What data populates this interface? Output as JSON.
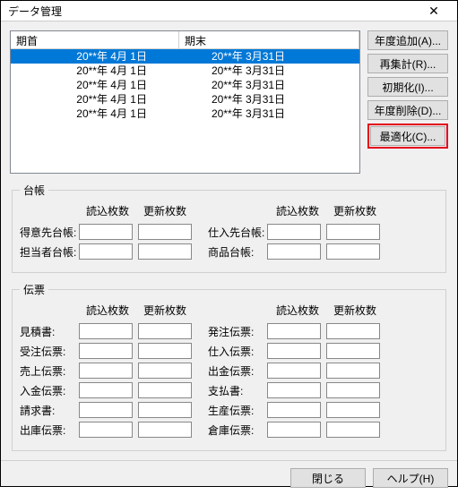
{
  "window": {
    "title": "データ管理"
  },
  "list": {
    "headers": {
      "start": "期首",
      "end": "期末"
    },
    "rows": [
      {
        "start": "20**年 4月 1日",
        "end": "20**年 3月31日",
        "selected": true
      },
      {
        "start": "20**年 4月 1日",
        "end": "20**年 3月31日",
        "selected": false
      },
      {
        "start": "20**年 4月 1日",
        "end": "20**年 3月31日",
        "selected": false
      },
      {
        "start": "20**年 4月 1日",
        "end": "20**年 3月31日",
        "selected": false
      },
      {
        "start": "20**年 4月 1日",
        "end": "20**年 3月31日",
        "selected": false
      }
    ]
  },
  "sidebuttons": {
    "add_year": "年度追加(A)...",
    "reaggregate": "再集計(R)...",
    "init": "初期化(I)...",
    "delete_year": "年度削除(D)...",
    "optimize": "最適化(C)..."
  },
  "ledger": {
    "legend": "台帳",
    "col_read": "読込枚数",
    "col_update": "更新枚数",
    "left": [
      {
        "label": "得意先台帳:"
      },
      {
        "label": "担当者台帳:"
      }
    ],
    "right": [
      {
        "label": "仕入先台帳:"
      },
      {
        "label": "商品台帳:"
      }
    ]
  },
  "voucher": {
    "legend": "伝票",
    "col_read": "読込枚数",
    "col_update": "更新枚数",
    "left": [
      {
        "label": "見積書:"
      },
      {
        "label": "受注伝票:"
      },
      {
        "label": "売上伝票:"
      },
      {
        "label": "入金伝票:"
      },
      {
        "label": "請求書:"
      },
      {
        "label": "出庫伝票:"
      }
    ],
    "right": [
      {
        "label": "発注伝票:"
      },
      {
        "label": "仕入伝票:"
      },
      {
        "label": "出金伝票:"
      },
      {
        "label": "支払書:"
      },
      {
        "label": "生産伝票:"
      },
      {
        "label": "倉庫伝票:"
      }
    ]
  },
  "footer": {
    "close": "閉じる",
    "help": "ヘルプ(H)"
  }
}
